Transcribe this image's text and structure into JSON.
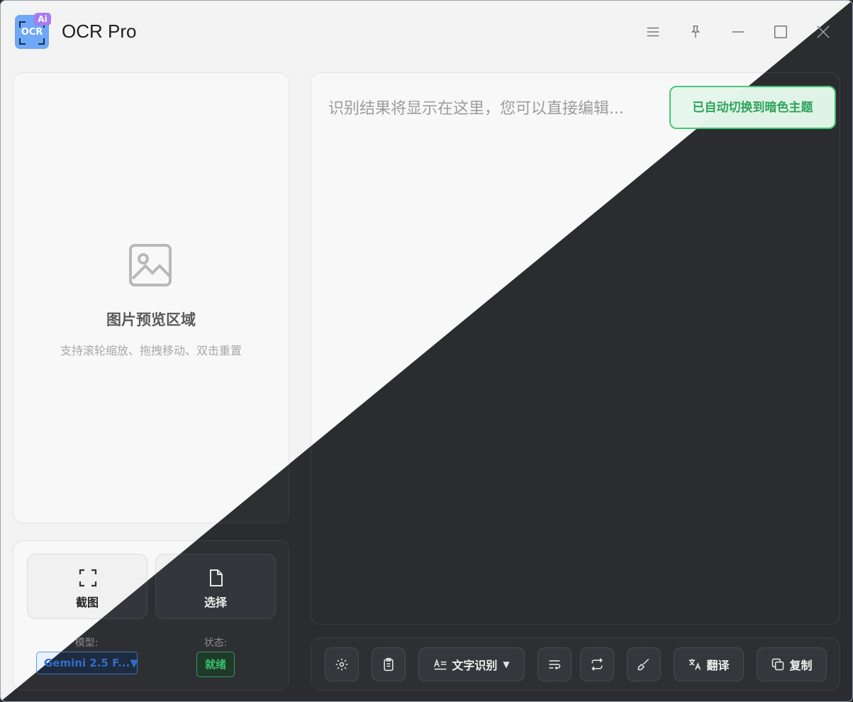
{
  "app": {
    "title": "OCR Pro",
    "logo_text": "OCR",
    "logo_badge": "Ai"
  },
  "window_controls": [
    "menu-icon",
    "pin-icon",
    "minimize-icon",
    "maximize-icon",
    "close-icon"
  ],
  "preview": {
    "title": "图片预览区域",
    "hint": "支持滚轮缩放、拖拽移动、双击重置"
  },
  "actions": {
    "capture_label": "截图",
    "select_label": "选择"
  },
  "meta": {
    "model_label": "模型:",
    "model_value": "Gemini 2.5 F...",
    "model_caret": "▼",
    "status_label": "状态:",
    "status_value": "就绪"
  },
  "editor": {
    "placeholder": "识别结果将显示在这里，您可以直接编辑..."
  },
  "toast": {
    "message": "已自动切换到暗色主题"
  },
  "toolbar": {
    "ocr_label": "文字识别",
    "ocr_caret": "▼",
    "translate_label": "翻译",
    "copy_label": "复制"
  },
  "theme_colors": {
    "light_bg": "#f3f3f3",
    "dark_bg": "#2b2c30",
    "accent_blue": "#2b6fd1",
    "accent_green": "#2ea35c",
    "logo_blue": "#6ea8f7",
    "badge_purple": "#a77bf3"
  }
}
